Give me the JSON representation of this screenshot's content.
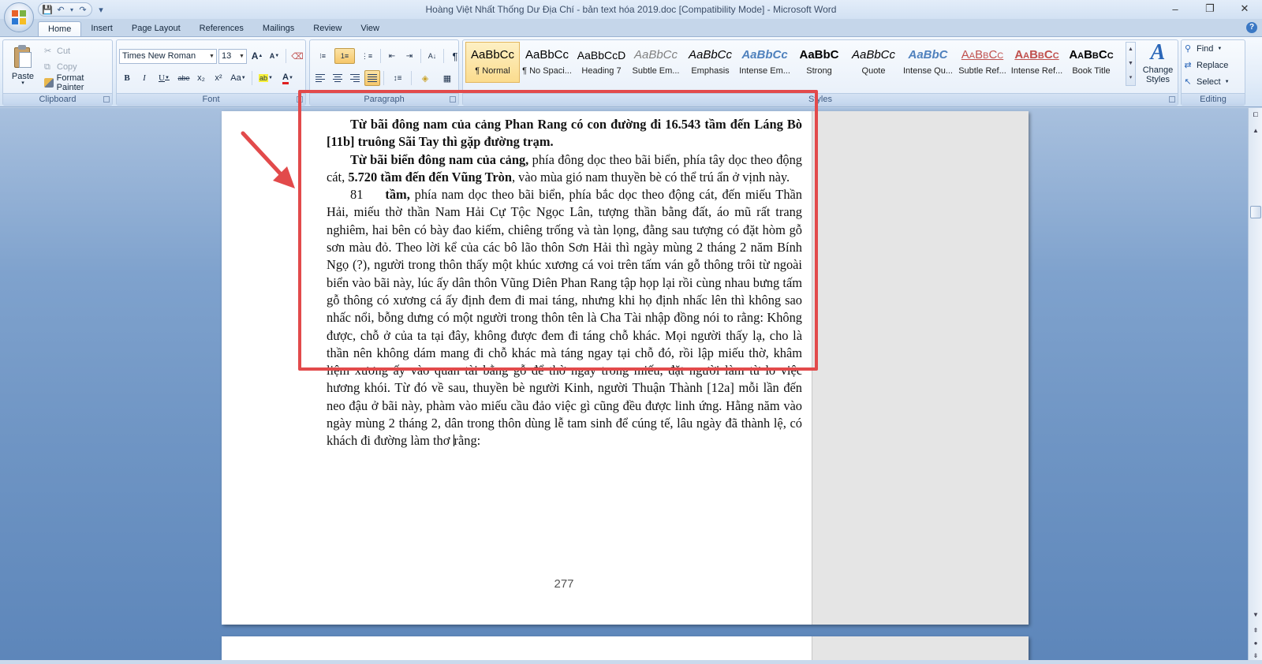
{
  "window": {
    "title": "Hoàng Việt Nhất Thống Dư Địa Chí - bản text hóa 2019.doc [Compatibility Mode] - Microsoft Word",
    "minimize": "–",
    "restore": "❐",
    "close": "✕"
  },
  "qat": {
    "save": "💾",
    "undo": "↶",
    "undo_drop": "▾",
    "redo": "↷",
    "customize": "▾"
  },
  "tabs": [
    "Home",
    "Insert",
    "Page Layout",
    "References",
    "Mailings",
    "Review",
    "View"
  ],
  "help": "?",
  "clipboard": {
    "paste": "Paste",
    "paste_arrow": "▾",
    "cut": "Cut",
    "copy": "Copy",
    "format_painter": "Format Painter",
    "group_label": "Clipboard"
  },
  "font": {
    "font_name": "Times New Roman",
    "font_size": "13",
    "grow": "A",
    "shrink": "A",
    "clear": "⌫",
    "bold": "B",
    "italic": "I",
    "underline": "U",
    "strike": "abe",
    "subscript": "x₂",
    "superscript": "x²",
    "change_case": "Aa",
    "highlight": "ab",
    "font_color": "A",
    "group_label": "Font"
  },
  "paragraph": {
    "show_marks": "¶",
    "sort": "A↓",
    "group_label": "Paragraph"
  },
  "styles": {
    "items": [
      {
        "sample": "AaBbCc",
        "name": "¶ Normal"
      },
      {
        "sample": "AaBbCc",
        "name": "¶ No Spaci..."
      },
      {
        "sample": "AaBbCcD",
        "name": "Heading 7"
      },
      {
        "sample": "AaBbCc",
        "name": "Subtle Em..."
      },
      {
        "sample": "AaBbCc",
        "name": "Emphasis"
      },
      {
        "sample": "AaBbCc",
        "name": "Intense Em..."
      },
      {
        "sample": "AaBbC",
        "name": "Strong"
      },
      {
        "sample": "AaBbCc",
        "name": "Quote"
      },
      {
        "sample": "AaBbC",
        "name": "Intense Qu..."
      },
      {
        "sample": "AaBbCc",
        "name": "Subtle Ref..."
      },
      {
        "sample": "AaBbCc",
        "name": "Intense Ref..."
      },
      {
        "sample": "AaBbCc",
        "name": "Book Title"
      }
    ],
    "change_styles_line1": "Change",
    "change_styles_line2": "Styles",
    "change_styles_icon": "A",
    "group_label": "Styles"
  },
  "editing": {
    "find": "Find",
    "replace": "Replace",
    "select": "Select",
    "group_label": "Editing"
  },
  "document": {
    "para1_bold": "Từ bãi đông nam của cảng Phan Rang có con đường đi 16.543 tầm đến Láng Bò [11b] truông Sãi Tay thì gặp đường trạm.",
    "para2_bold": "Từ bãi biển đông nam của cảng,",
    "para2_a": " phía đông dọc theo bãi biển, phía tây dọc theo động cát, ",
    "para2_bold2": "5.720 tầm đến đến Vũng Tròn",
    "para2_b": ", vào mùa gió nam thuyền bè có thể trú ẩn ở vịnh này.",
    "para3_num": "81",
    "para3_tam": "tầm,",
    "para3_text": " phía nam dọc theo bãi biển, phía bắc dọc theo động cát, đến miếu Thần Hải, miếu thờ thần Nam Hải Cự Tộc Ngọc Lân, tượng thần bằng đất, áo mũ rất trang nghiêm, hai bên có bày đao kiếm, chiêng trống và tàn lọng, đằng sau tượng có đặt hòm gỗ sơn màu đỏ. Theo lời kể của các bô lão thôn Sơn Hải thì ngày mùng 2 tháng 2 năm Bính Ngọ (?), người trong thôn thấy một khúc xương cá voi trên tấm ván gỗ thông trôi từ ngoài biển vào bãi này, lúc ấy dân thôn Vũng Diên Phan Rang tập họp lại rồi cùng nhau bưng tấm gỗ thông có xương cá ấy định đem đi mai táng, nhưng khi họ định nhấc lên thì không sao nhấc nổi, bỗng dưng có một người trong thôn tên là Cha Tài nhập đồng nói to rằng: Không được, chỗ ở của ta tại đây, không được đem đi táng chỗ khác. Mọi người thấy lạ, cho là thần nên không dám mang đi chỗ khác mà táng ngay tại chỗ đó, rồi lập miếu thờ, khâm liệm xương ấy vào quan tài bằng gỗ để thờ ngay trong miếu, đặt người làm từ lo việc hương khói. Từ đó về sau, thuyền bè người Kinh, người Thuận Thành [12a] mỗi lần đến neo đậu ở bãi này, phàm vào miếu cầu đảo việc gì cũng đều được linh ứng. Hằng năm vào ngày mùng 2 tháng 2, dân trong thôn dùng lễ tam sinh để cúng tế, lâu ngày đã thành lệ, có khách đi đường làm thơ ",
    "para3_end": "rằng:",
    "page_number": "277"
  },
  "annotation": {
    "arrow_color": "#e24a4b",
    "box_color": "#e24a4b"
  },
  "scrollbar": {
    "up": "▲",
    "down": "▼",
    "prev": "⇞",
    "select": "●",
    "next": "⇟"
  }
}
